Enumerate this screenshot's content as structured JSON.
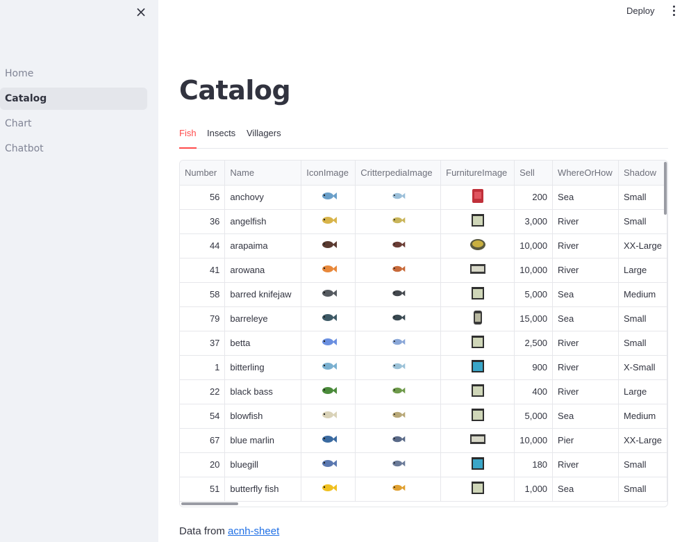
{
  "sidebar": {
    "close_icon": "×",
    "items": [
      {
        "label": "Home",
        "active": false
      },
      {
        "label": "Catalog",
        "active": true
      },
      {
        "label": "Chart",
        "active": false
      },
      {
        "label": "Chatbot",
        "active": false
      }
    ]
  },
  "header": {
    "deploy_label": "Deploy",
    "menu_icon": "kebab-menu-icon"
  },
  "main": {
    "title": "Catalog",
    "tabs": [
      {
        "label": "Fish",
        "active": true
      },
      {
        "label": "Insects",
        "active": false
      },
      {
        "label": "Villagers",
        "active": false
      }
    ],
    "table": {
      "columns": [
        "Number",
        "Name",
        "IconImage",
        "CritterpediaImage",
        "FurnitureImage",
        "Sell",
        "WhereOrHow",
        "Shadow"
      ],
      "rows": [
        {
          "number": "56",
          "name": "anchovy",
          "icon_color": "#6a9fc9",
          "critter_color": "#9bbfd9",
          "furniture": "red-tank",
          "sell": "200",
          "where": "Sea",
          "shadow": "Small"
        },
        {
          "number": "36",
          "name": "angelfish",
          "icon_color": "#d8b44a",
          "critter_color": "#c9b55a",
          "furniture": "tank",
          "sell": "3,000",
          "where": "River",
          "shadow": "Small"
        },
        {
          "number": "44",
          "name": "arapaima",
          "icon_color": "#5a3a30",
          "critter_color": "#6b3d35",
          "furniture": "round-tank",
          "sell": "10,000",
          "where": "River",
          "shadow": "XX-Large"
        },
        {
          "number": "41",
          "name": "arowana",
          "icon_color": "#e8883a",
          "critter_color": "#c86a3a",
          "furniture": "wide-tank",
          "sell": "10,000",
          "where": "River",
          "shadow": "Large"
        },
        {
          "number": "58",
          "name": "barred knifejaw",
          "icon_color": "#555a60",
          "critter_color": "#44484e",
          "furniture": "tank",
          "sell": "5,000",
          "where": "Sea",
          "shadow": "Medium"
        },
        {
          "number": "79",
          "name": "barreleye",
          "icon_color": "#3e5a66",
          "critter_color": "#3a4a52",
          "furniture": "cylinder-tank",
          "sell": "15,000",
          "where": "Sea",
          "shadow": "Small"
        },
        {
          "number": "37",
          "name": "betta",
          "icon_color": "#6a8fe0",
          "critter_color": "#8aa7d8",
          "furniture": "tank",
          "sell": "2,500",
          "where": "River",
          "shadow": "Small"
        },
        {
          "number": "1",
          "name": "bitterling",
          "icon_color": "#7ab0d0",
          "critter_color": "#9cc2d8",
          "furniture": "blue-tank",
          "sell": "900",
          "where": "River",
          "shadow": "X-Small"
        },
        {
          "number": "22",
          "name": "black bass",
          "icon_color": "#4a8a3a",
          "critter_color": "#6e9a4a",
          "furniture": "tank",
          "sell": "400",
          "where": "River",
          "shadow": "Large"
        },
        {
          "number": "54",
          "name": "blowfish",
          "icon_color": "#d9d2b8",
          "critter_color": "#b8a878",
          "furniture": "tank",
          "sell": "5,000",
          "where": "Sea",
          "shadow": "Medium"
        },
        {
          "number": "67",
          "name": "blue marlin",
          "icon_color": "#3a6aa0",
          "critter_color": "#5a6a88",
          "furniture": "wide-tank",
          "sell": "10,000",
          "where": "Pier",
          "shadow": "XX-Large"
        },
        {
          "number": "20",
          "name": "bluegill",
          "icon_color": "#5a78b0",
          "critter_color": "#6a7a98",
          "furniture": "blue-tank",
          "sell": "180",
          "where": "River",
          "shadow": "Small"
        },
        {
          "number": "51",
          "name": "butterfly fish",
          "icon_color": "#f0c020",
          "critter_color": "#e0a030",
          "furniture": "tank",
          "sell": "1,000",
          "where": "Sea",
          "shadow": "Small"
        }
      ]
    }
  },
  "footer": {
    "prefix": "Data from ",
    "link_text": "acnh-sheet"
  }
}
